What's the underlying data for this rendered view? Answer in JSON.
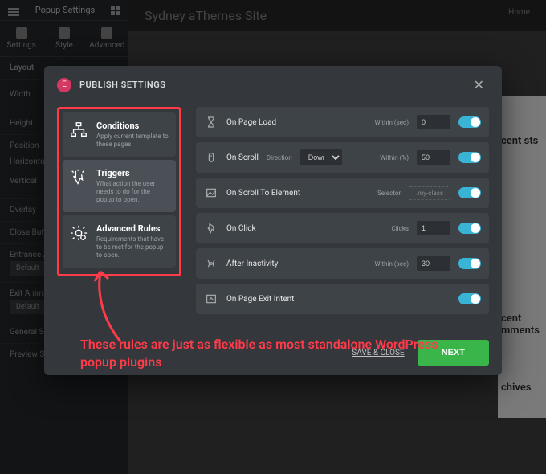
{
  "bg": {
    "sidebar_title": "Popup Settings",
    "tabs": {
      "settings": "Settings",
      "style": "Style",
      "advanced": "Advanced"
    },
    "section_layout": "Layout",
    "width": "Width",
    "height": "Height",
    "position": "Position",
    "horizontal": "Horizontal",
    "vertical": "Vertical",
    "overlay": "Overlay",
    "close_button": "Close Button",
    "entrance_anim": "Entrance Animation",
    "exit_anim": "Exit Animation",
    "default_opt": "Default",
    "general": "General Settings",
    "preview": "Preview Settings",
    "site_title": "Sydney aThemes Site",
    "nav_home": "Home",
    "widget_recent_posts": "cent sts",
    "widget_recent_comments": "cent mments",
    "widget_archives": "chives"
  },
  "modal": {
    "title": "PUBLISH SETTINGS",
    "logo_letter": "E",
    "close": "✕",
    "rules": [
      {
        "title": "Conditions",
        "desc": "Apply current template to these pages."
      },
      {
        "title": "Triggers",
        "desc": "What action the user needs to do for the popup to open."
      },
      {
        "title": "Advanced Rules",
        "desc": "Requirements that have to be met for the popup to open."
      }
    ],
    "triggers": {
      "onload": {
        "name": "On Page Load",
        "label": "Within (sec)",
        "value": "0"
      },
      "onscroll": {
        "name": "On Scroll",
        "dir_label": "Direction",
        "dir_value": "Down",
        "within_label": "Within (%)",
        "within_value": "50"
      },
      "scrollto": {
        "name": "On Scroll To Element",
        "label": "Selector",
        "placeholder": ".my-class"
      },
      "onclick": {
        "name": "On Click",
        "label": "Clicks",
        "value": "1"
      },
      "inactivity": {
        "name": "After Inactivity",
        "label": "Within (sec)",
        "value": "30"
      },
      "exit": {
        "name": "On Page Exit Intent"
      }
    },
    "save_close": "SAVE & CLOSE",
    "next": "NEXT"
  },
  "annotation": "These rules are just as flexible as most standalone WordPress popup plugins"
}
